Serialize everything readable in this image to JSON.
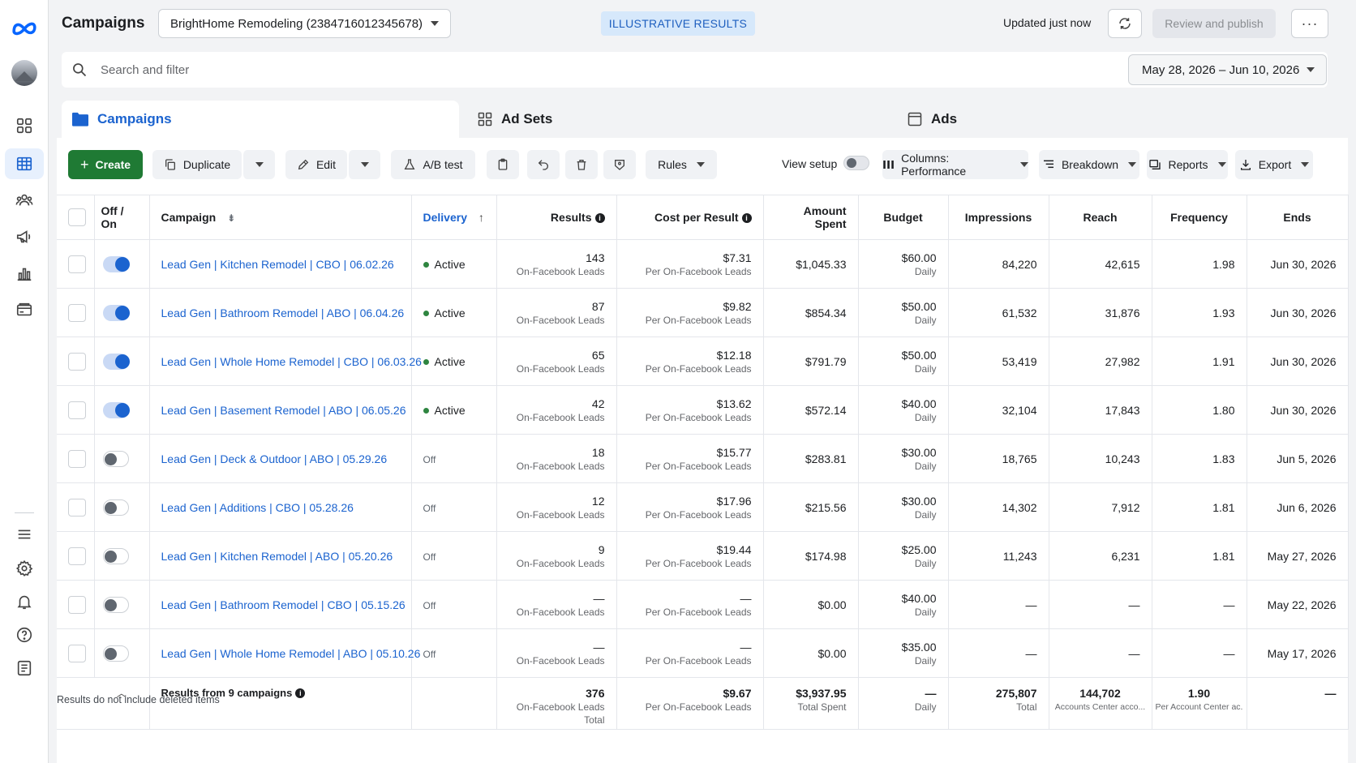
{
  "header": {
    "title": "Campaigns",
    "account": "BrightHome Remodeling (2384716012345678)",
    "banner": "ILLUSTRATIVE RESULTS",
    "updated": "Updated just now",
    "review_publish": "Review and publish",
    "more": "···"
  },
  "search": {
    "placeholder": "Search and filter",
    "date_range": "May 28, 2026 – Jun 10, 2026"
  },
  "tabs": [
    {
      "label": "Campaigns"
    },
    {
      "label": "Ad Sets"
    },
    {
      "label": "Ads"
    }
  ],
  "toolbar": {
    "create": "Create",
    "duplicate": "Duplicate",
    "edit": "Edit",
    "ab_test": "A/B test",
    "rules": "Rules",
    "view_setup": "View setup",
    "columns": "Columns: Performance",
    "breakdown": "Breakdown",
    "reports": "Reports",
    "export": "Export"
  },
  "columns": {
    "offon": "Off / On",
    "campaign": "Campaign",
    "delivery": "Delivery",
    "results": "Results",
    "cost_per_result": "Cost per Result",
    "amount_spent": "Amount Spent",
    "budget": "Budget",
    "impressions": "Impressions",
    "reach": "Reach",
    "frequency": "Frequency",
    "ends": "Ends"
  },
  "rows": [
    {
      "on": true,
      "name": "Lead Gen | Kitchen Remodel | CBO | 06.02.26",
      "delivery": "Active",
      "results": "143",
      "results_sub": "On-Facebook Leads",
      "cpr": "$7.31",
      "cpr_sub": "Per On-Facebook Leads",
      "spent": "$1,045.33",
      "budget": "$60.00",
      "budget_sub": "Daily",
      "impressions": "84,220",
      "reach": "42,615",
      "frequency": "1.98",
      "ends": "Jun 30, 2026"
    },
    {
      "on": true,
      "name": "Lead Gen | Bathroom Remodel | ABO | 06.04.26",
      "delivery": "Active",
      "results": "87",
      "results_sub": "On-Facebook Leads",
      "cpr": "$9.82",
      "cpr_sub": "Per On-Facebook Leads",
      "spent": "$854.34",
      "budget": "$50.00",
      "budget_sub": "Daily",
      "impressions": "61,532",
      "reach": "31,876",
      "frequency": "1.93",
      "ends": "Jun 30, 2026"
    },
    {
      "on": true,
      "name": "Lead Gen | Whole Home Remodel | CBO | 06.03.26",
      "delivery": "Active",
      "results": "65",
      "results_sub": "On-Facebook Leads",
      "cpr": "$12.18",
      "cpr_sub": "Per On-Facebook Leads",
      "spent": "$791.79",
      "budget": "$50.00",
      "budget_sub": "Daily",
      "impressions": "53,419",
      "reach": "27,982",
      "frequency": "1.91",
      "ends": "Jun 30, 2026"
    },
    {
      "on": true,
      "name": "Lead Gen | Basement Remodel | ABO | 06.05.26",
      "delivery": "Active",
      "results": "42",
      "results_sub": "On-Facebook Leads",
      "cpr": "$13.62",
      "cpr_sub": "Per On-Facebook Leads",
      "spent": "$572.14",
      "budget": "$40.00",
      "budget_sub": "Daily",
      "impressions": "32,104",
      "reach": "17,843",
      "frequency": "1.80",
      "ends": "Jun 30, 2026"
    },
    {
      "on": false,
      "name": "Lead Gen | Deck & Outdoor | ABO | 05.29.26",
      "delivery": "Off",
      "results": "18",
      "results_sub": "On-Facebook Leads",
      "cpr": "$15.77",
      "cpr_sub": "Per On-Facebook Leads",
      "spent": "$283.81",
      "budget": "$30.00",
      "budget_sub": "Daily",
      "impressions": "18,765",
      "reach": "10,243",
      "frequency": "1.83",
      "ends": "Jun 5, 2026"
    },
    {
      "on": false,
      "name": "Lead Gen | Additions | CBO | 05.28.26",
      "delivery": "Off",
      "results": "12",
      "results_sub": "On-Facebook Leads",
      "cpr": "$17.96",
      "cpr_sub": "Per On-Facebook Leads",
      "spent": "$215.56",
      "budget": "$30.00",
      "budget_sub": "Daily",
      "impressions": "14,302",
      "reach": "7,912",
      "frequency": "1.81",
      "ends": "Jun 6, 2026"
    },
    {
      "on": false,
      "name": "Lead Gen | Kitchen Remodel | ABO | 05.20.26",
      "delivery": "Off",
      "results": "9",
      "results_sub": "On-Facebook Leads",
      "cpr": "$19.44",
      "cpr_sub": "Per On-Facebook Leads",
      "spent": "$174.98",
      "budget": "$25.00",
      "budget_sub": "Daily",
      "impressions": "11,243",
      "reach": "6,231",
      "frequency": "1.81",
      "ends": "May 27, 2026"
    },
    {
      "on": false,
      "name": "Lead Gen | Bathroom Remodel | CBO | 05.15.26",
      "delivery": "Off",
      "results": "—",
      "results_sub": "On-Facebook Leads",
      "cpr": "—",
      "cpr_sub": "Per On-Facebook Leads",
      "spent": "$0.00",
      "budget": "$40.00",
      "budget_sub": "Daily",
      "impressions": "—",
      "reach": "—",
      "frequency": "—",
      "ends": "May 22, 2026"
    },
    {
      "on": false,
      "name": "Lead Gen | Whole Home Remodel | ABO | 05.10.26",
      "delivery": "Off",
      "results": "—",
      "results_sub": "On-Facebook Leads",
      "cpr": "—",
      "cpr_sub": "Per On-Facebook Leads",
      "spent": "$0.00",
      "budget": "$35.00",
      "budget_sub": "Daily",
      "impressions": "—",
      "reach": "—",
      "frequency": "—",
      "ends": "May 17, 2026"
    }
  ],
  "totals": {
    "label": "Results from 9 campaigns",
    "results": "376",
    "results_sub": "On-Facebook Leads",
    "results_sub2": "Total",
    "cpr": "$9.67",
    "cpr_sub": "Per On-Facebook Leads",
    "spent": "$3,937.95",
    "spent_sub": "Total Spent",
    "budget": "—",
    "budget_sub": "Daily",
    "impressions": "275,807",
    "impressions_sub": "Total",
    "reach": "144,702",
    "reach_sub": "Accounts Center acco...",
    "frequency": "1.90",
    "frequency_sub": "Per Account Center ac...",
    "ends": "—"
  },
  "footnote": "Results do not include deleted items",
  "colors": {
    "accent": "#1b63cf",
    "create": "#1f7a34",
    "active_dot": "#2e8540"
  }
}
